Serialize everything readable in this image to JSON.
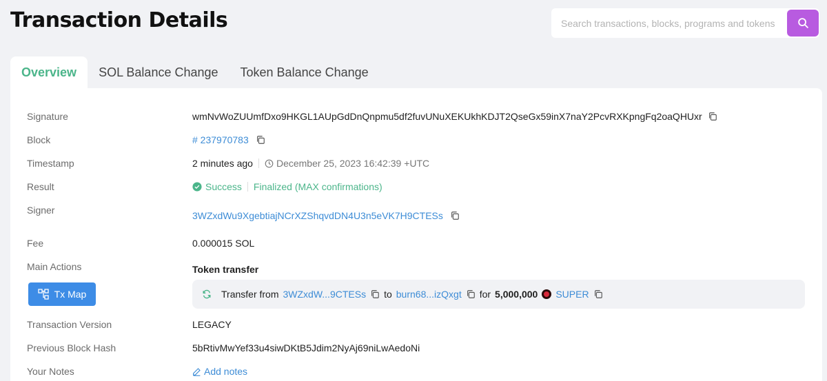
{
  "page": {
    "title": "Transaction Details"
  },
  "search": {
    "placeholder": "Search transactions, blocks, programs and tokens"
  },
  "tabs": [
    {
      "label": "Overview",
      "active": true
    },
    {
      "label": "SOL Balance Change",
      "active": false
    },
    {
      "label": "Token Balance Change",
      "active": false
    }
  ],
  "details": {
    "signature": {
      "label": "Signature",
      "value": "wmNvWoZUUmfDxo9HKGL1AUpGdDnQnpmu5df2fuvUNuXEKUkhKDJT2QseGx59inX7naY2PcvRXKpngFq2oaQHUxr"
    },
    "block": {
      "label": "Block",
      "value": "# 237970783"
    },
    "timestamp": {
      "label": "Timestamp",
      "relative": "2 minutes ago",
      "absolute": "December 25, 2023 16:42:39 +UTC"
    },
    "result": {
      "label": "Result",
      "status": "Success",
      "finality": "Finalized (MAX confirmations)"
    },
    "signer": {
      "label": "Signer",
      "value": "3WZxdWu9XgebtiajNCrXZShqvdDN4U3n5eVK7H9CTESs"
    },
    "fee": {
      "label": "Fee",
      "value": "0.000015 SOL"
    },
    "main_actions": {
      "label": "Main Actions",
      "title": "Token transfer",
      "tx_map_label": "Tx Map",
      "transfer": {
        "prefix": "Transfer from",
        "from": "3WZxdW...9CTESs",
        "to_word": "to",
        "to": "burn68...izQxgt",
        "for_word": "for",
        "amount": "5,000,000",
        "token": "SUPER"
      }
    },
    "version": {
      "label": "Transaction Version",
      "value": "LEGACY"
    },
    "prev_hash": {
      "label": "Previous Block Hash",
      "value": "5bRtivMwYef33u4siwDKtB5Jdim2NyAj69niLwAedoNi"
    },
    "notes": {
      "label": "Your Notes",
      "action": "Add notes"
    }
  },
  "colors": {
    "accent": "#4bb58a",
    "link": "#3d8cd6",
    "search_button": "#b85be0",
    "tx_map_button": "#3d8ce6"
  },
  "icons": [
    "search-icon",
    "copy-icon",
    "clock-icon",
    "check-circle-icon",
    "tx-map-icon",
    "refresh-icon",
    "token-icon",
    "edit-icon"
  ]
}
